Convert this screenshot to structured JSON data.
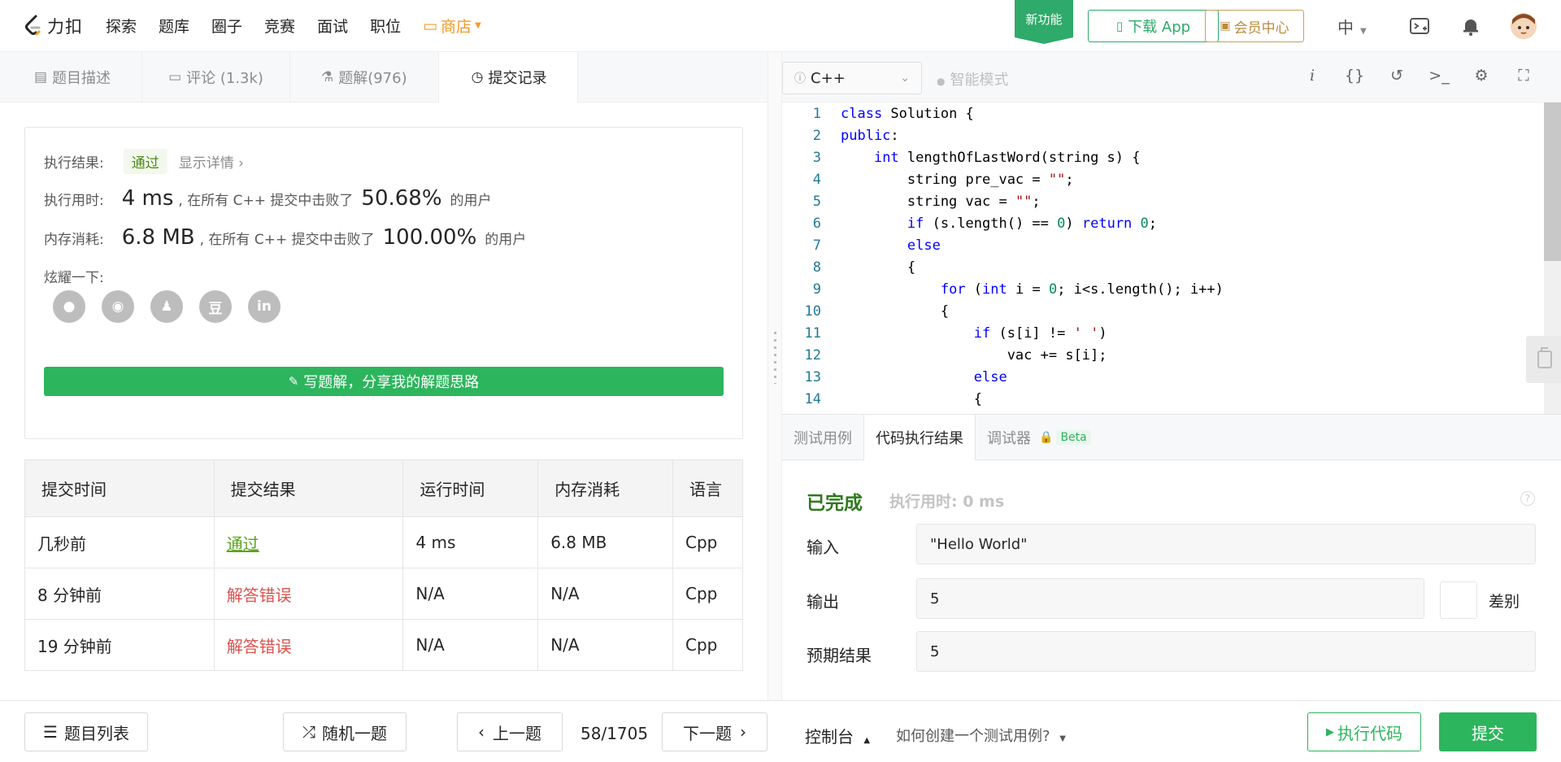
{
  "nav": {
    "logo_text": "力扣",
    "items": [
      "探索",
      "题库",
      "圈子",
      "竞赛",
      "面试",
      "职位"
    ],
    "store": "商店",
    "new_feature": "新功能",
    "download_app": "下载 App",
    "vip_center": "会员中心",
    "language": "中"
  },
  "left_tabs": [
    {
      "label": "题目描述"
    },
    {
      "label": "评论 (1.3k)"
    },
    {
      "label": "题解(976)"
    },
    {
      "label": "提交记录"
    }
  ],
  "result": {
    "exec_result_label": "执行结果:",
    "exec_result_value": "通过",
    "show_detail": "显示详情 ›",
    "time_label": "执行用时:",
    "time_value": "4 ms",
    "time_text": ", 在所有 C++ 提交中击败了",
    "time_pct": "50.68%",
    "time_suffix": "的用户",
    "mem_label": "内存消耗:",
    "mem_value": "6.8 MB",
    "mem_text": ", 在所有 C++ 提交中击败了",
    "mem_pct": "100.00%",
    "mem_suffix": "的用户",
    "share_label": "炫耀一下:",
    "write_solution": "写题解，分享我的解题思路"
  },
  "submissions": {
    "headers": [
      "提交时间",
      "提交结果",
      "运行时间",
      "内存消耗",
      "语言"
    ],
    "rows": [
      {
        "time": "几秒前",
        "result": "通过",
        "runtime": "4 ms",
        "memory": "6.8 MB",
        "lang": "Cpp"
      },
      {
        "time": "8 分钟前",
        "result": "解答错误",
        "runtime": "N/A",
        "memory": "N/A",
        "lang": "Cpp"
      },
      {
        "time": "19 分钟前",
        "result": "解答错误",
        "runtime": "N/A",
        "memory": "N/A",
        "lang": "Cpp"
      }
    ]
  },
  "editor": {
    "language": "C++",
    "smart_mode": "智能模式",
    "lines": [
      "class Solution {",
      "public:",
      "    int lengthOfLastWord(string s) {",
      "        string pre_vac = \"\";",
      "        string vac = \"\";",
      "        if (s.length() == 0) return 0;",
      "        else",
      "        {",
      "            for (int i = 0; i<s.length(); i++)",
      "            {",
      "                if (s[i] != ' ')",
      "                    vac += s[i];",
      "                else",
      "                {"
    ]
  },
  "console": {
    "tabs": [
      "测试用例",
      "代码执行结果",
      "调试器"
    ],
    "beta": "Beta",
    "status": "已完成",
    "exec_time": "执行用时: 0 ms",
    "input_label": "输入",
    "input_value": "\"Hello World\"",
    "output_label": "输出",
    "output_value": "5",
    "diff_label": "差别",
    "expected_label": "预期结果",
    "expected_value": "5"
  },
  "footer": {
    "problem_list": "题目列表",
    "random": "随机一题",
    "prev": "上一题",
    "page": "58/1705",
    "next": "下一题",
    "console": "控制台",
    "howto": "如何创建一个测试用例?",
    "run": "执行代码",
    "submit": "提交"
  }
}
